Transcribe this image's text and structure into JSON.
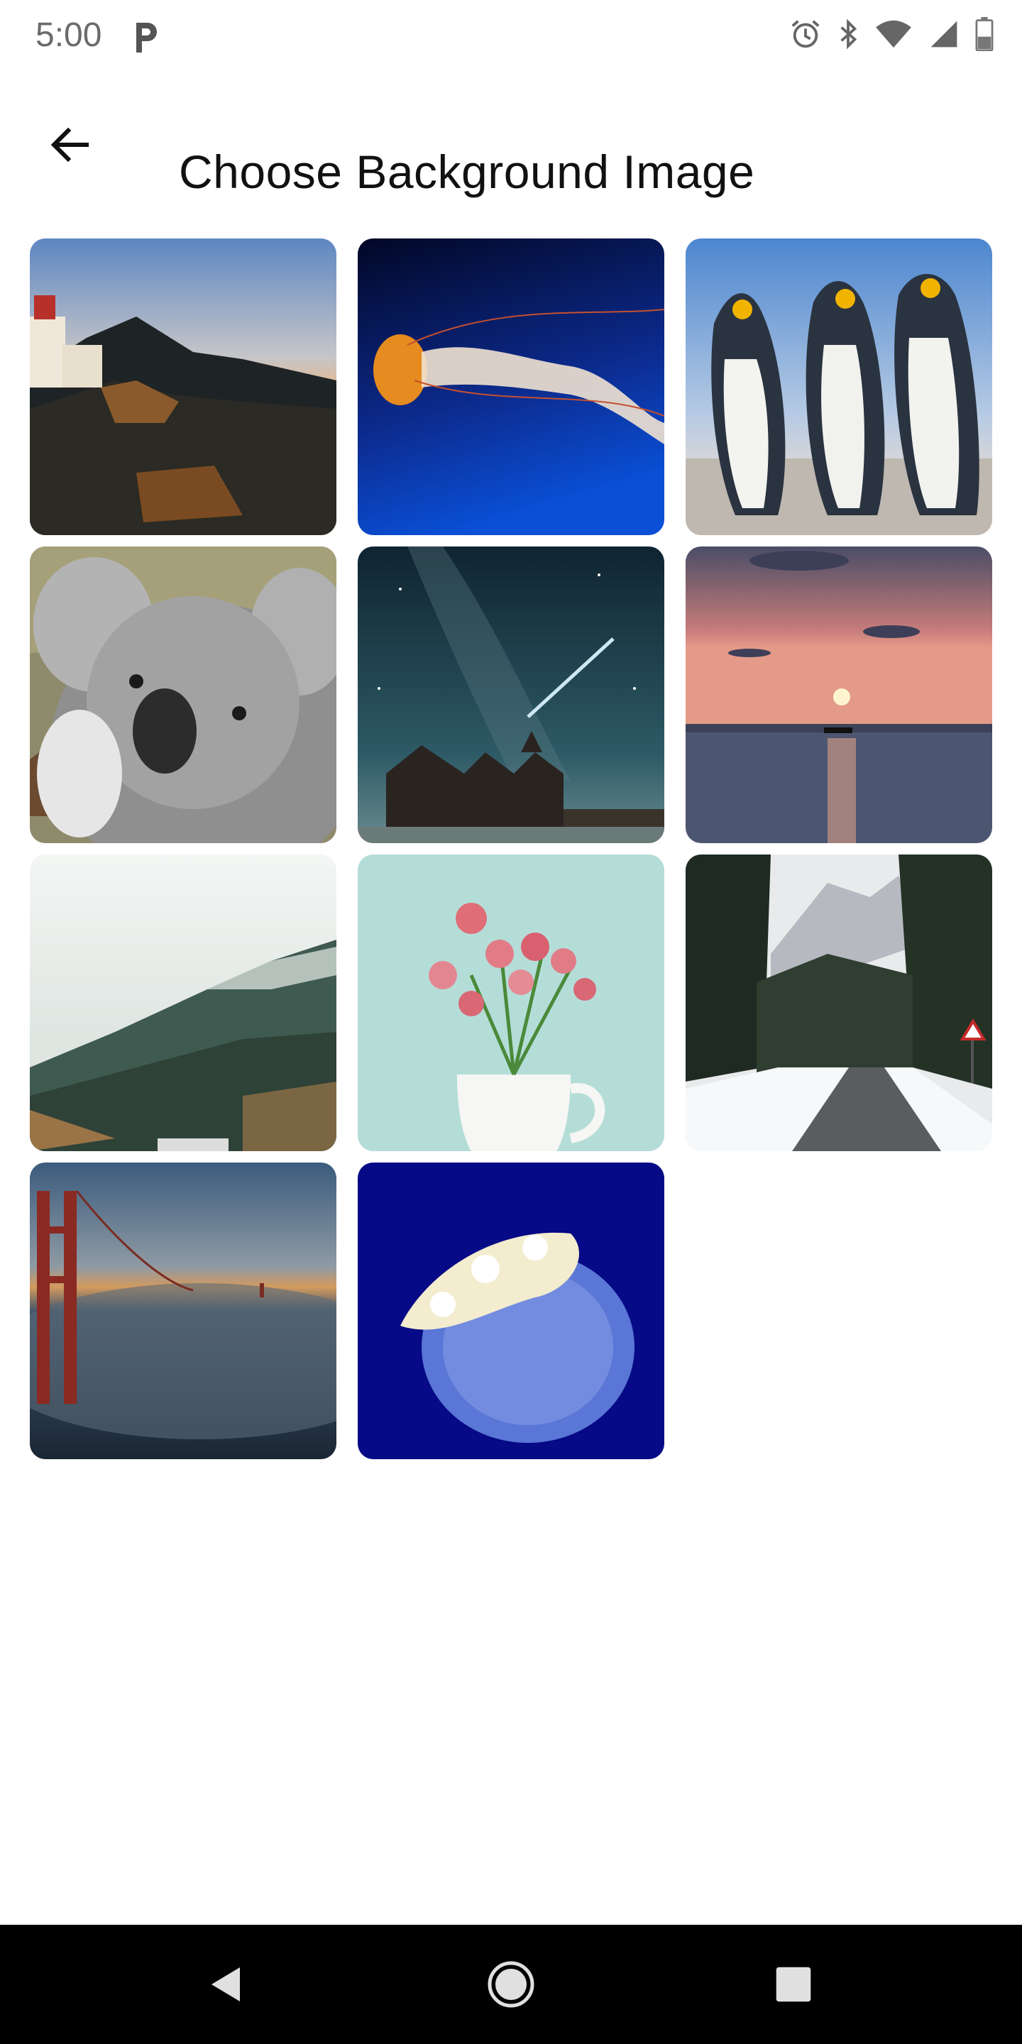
{
  "status_bar": {
    "time": "5:00",
    "icons": [
      "parking-icon",
      "alarm-icon",
      "bluetooth-icon",
      "wifi-icon",
      "signal-icon",
      "battery-icon"
    ]
  },
  "app_bar": {
    "title": "Choose Background Image",
    "back_icon": "arrow-back-icon"
  },
  "images": [
    {
      "name": "lighthouse-cliff-sunset",
      "selected": false
    },
    {
      "name": "orange-jellyfish",
      "selected": false
    },
    {
      "name": "penguins",
      "selected": false
    },
    {
      "name": "koala",
      "selected": false
    },
    {
      "name": "night-sky-church",
      "selected": false
    },
    {
      "name": "sea-sunset",
      "selected": false
    },
    {
      "name": "foggy-mountain",
      "selected": false
    },
    {
      "name": "pink-roses-vase",
      "selected": false
    },
    {
      "name": "snowy-forest-road",
      "selected": false
    },
    {
      "name": "golden-gate-fog",
      "selected": false
    },
    {
      "name": "blue-jellyfish",
      "selected": false
    }
  ],
  "nav_bar": {
    "back": "nav-back-icon",
    "home": "nav-home-icon",
    "recents": "nav-recents-icon"
  },
  "colors": {
    "background": "#ffffff",
    "title": "#111111",
    "status_text": "#6b6b6b",
    "nav_bar": "#000000"
  }
}
